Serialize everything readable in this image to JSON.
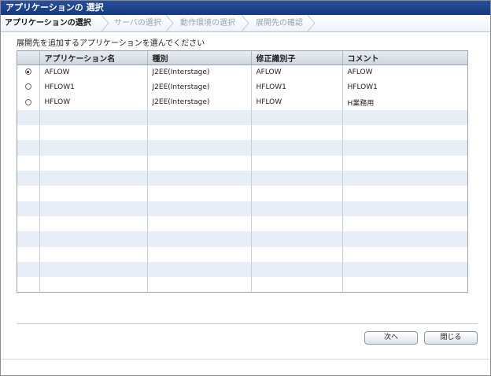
{
  "window": {
    "title": "アプリケーションの 選択"
  },
  "steps": [
    {
      "label": "アプリケーションの選択",
      "active": true
    },
    {
      "label": "サーバの選択",
      "active": false
    },
    {
      "label": "動作環境の選択",
      "active": false
    },
    {
      "label": "展開先の確認",
      "active": false
    }
  ],
  "prompt": "展開先を追加するアプリケーションを選んでください",
  "table": {
    "headers": [
      "",
      "アプリケーション名",
      "種別",
      "修正識別子",
      "コメント"
    ],
    "rows": [
      {
        "selected": true,
        "name": "AFLOW",
        "type": "J2EE(Interstage)",
        "id": "AFLOW",
        "comment": "AFLOW"
      },
      {
        "selected": false,
        "name": "HFLOW1",
        "type": "J2EE(Interstage)",
        "id": "HFLOW1",
        "comment": "HFLOW1"
      },
      {
        "selected": false,
        "name": "HFLOW",
        "type": "J2EE(Interstage)",
        "id": "HFLOW",
        "comment": "H業務用"
      }
    ]
  },
  "buttons": {
    "next": "次へ",
    "close": "閉じる"
  }
}
